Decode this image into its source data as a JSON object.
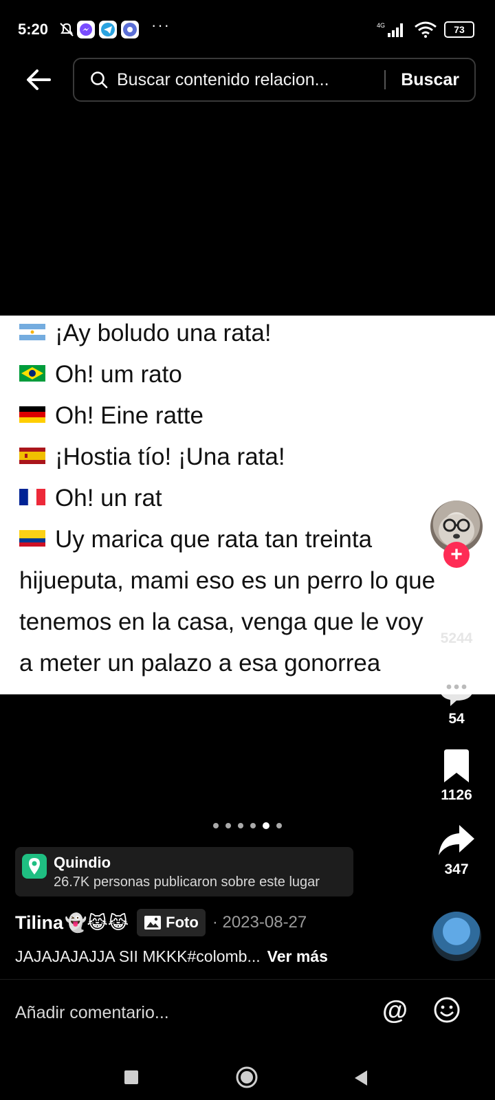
{
  "status_bar": {
    "time": "5:20",
    "network": "4G",
    "battery": "73"
  },
  "search": {
    "placeholder": "Buscar contenido relacion...",
    "button": "Buscar"
  },
  "post_text": {
    "lines": [
      {
        "flag": "argentina",
        "text": "¡Ay boludo una rata!"
      },
      {
        "flag": "brazil",
        "text": "Oh! um rato"
      },
      {
        "flag": "germany",
        "text": "Oh! Eine ratte"
      },
      {
        "flag": "spain",
        "text": "¡Hostia tío! ¡Una rata!"
      },
      {
        "flag": "france",
        "text": "Oh! un rat"
      },
      {
        "flag": "colombia",
        "text": "Uy marica que rata tan treinta"
      },
      {
        "flag": "",
        "text": "hijueputa, mami eso es un perro lo que"
      },
      {
        "flag": "",
        "text": "tenemos en la casa, venga que le voy"
      },
      {
        "flag": "",
        "text": "a meter un palazo a esa gonorrea"
      }
    ]
  },
  "actions": {
    "likes": "5244",
    "comments": "54",
    "saves": "1126",
    "shares": "347"
  },
  "carousel": {
    "count": 6,
    "active_index": 4
  },
  "location": {
    "name": "Quindio",
    "subtitle": "26.7K personas publicaron sobre este lugar"
  },
  "author": {
    "name": "Tilina",
    "emojis": "👻😹😹",
    "tag": "Foto",
    "date": "· 2023-08-27"
  },
  "caption": {
    "text": "JAJAJAJAJJA SII MKKK#colomb...",
    "more": "Ver más"
  },
  "comment_bar": {
    "placeholder": "Añadir comentario...",
    "at": "@"
  },
  "colors": {
    "accent": "#fe2c55",
    "location_pin": "#1fbf82"
  }
}
